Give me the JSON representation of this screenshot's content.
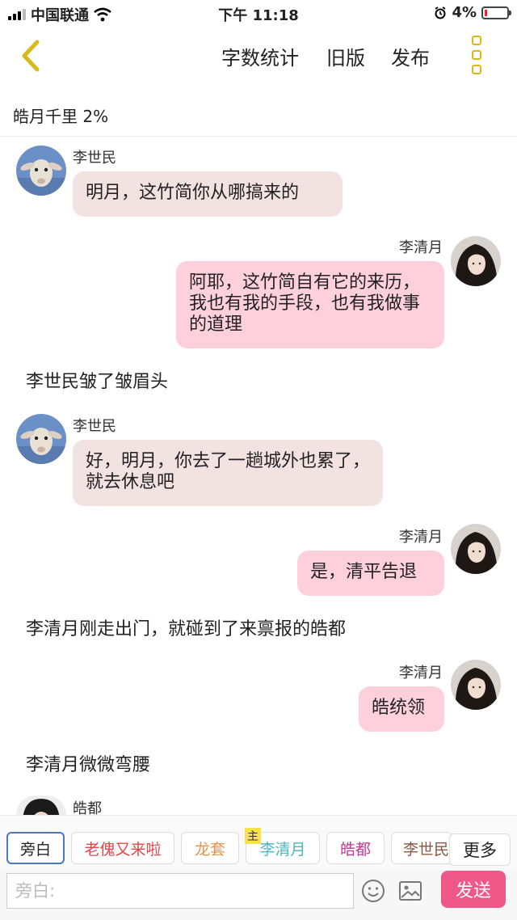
{
  "status_bar": {
    "carrier": "中国联通",
    "time": "下午 11:18",
    "battery": "4%"
  },
  "nav": {
    "word_count": "字数统计",
    "old_version": "旧版",
    "publish": "发布"
  },
  "progress_text": "皓月千里 2%",
  "messages": [
    {
      "type": "left",
      "name": "李世民",
      "text": "明月，这竹简你从哪搞来的"
    },
    {
      "type": "right",
      "name": "李清月",
      "text": "阿耶，这竹简自有它的来历，我也有我的手段，也有我做事的道理"
    },
    {
      "type": "narration",
      "text": "李世民皱了皱眉头"
    },
    {
      "type": "left",
      "name": "李世民",
      "text": "好，明月，你去了一趟城外也累了，就去休息吧"
    },
    {
      "type": "right",
      "name": "李清月",
      "text": "是，清平告退"
    },
    {
      "type": "narration",
      "text": "李清月刚走出门，就碰到了来禀报的皓都"
    },
    {
      "type": "right",
      "name": "李清月",
      "text": "皓统领"
    },
    {
      "type": "narration",
      "text": "李清月微微弯腰"
    },
    {
      "type": "left",
      "name": "皓都",
      "text": ""
    }
  ],
  "role_bar": {
    "roles": [
      {
        "label": "旁白",
        "color": "#222222"
      },
      {
        "label": "老傀又来啦",
        "color": "#e0474c"
      },
      {
        "label": "龙套",
        "color": "#e8924a"
      },
      {
        "label": "李清月",
        "color": "#4db6c4",
        "tag": "主"
      },
      {
        "label": "皓都",
        "color": "#c2378f"
      },
      {
        "label": "李世民",
        "color": "#8a5a44"
      }
    ],
    "more": "更多"
  },
  "input_bar": {
    "placeholder": "旁白:",
    "send": "发送"
  },
  "colors": {
    "accent_yellow": "#d9b91a",
    "send_button": "#f0588a",
    "bubble_right": "#fdd0dc",
    "bubble_left": "#f2e2e2"
  }
}
